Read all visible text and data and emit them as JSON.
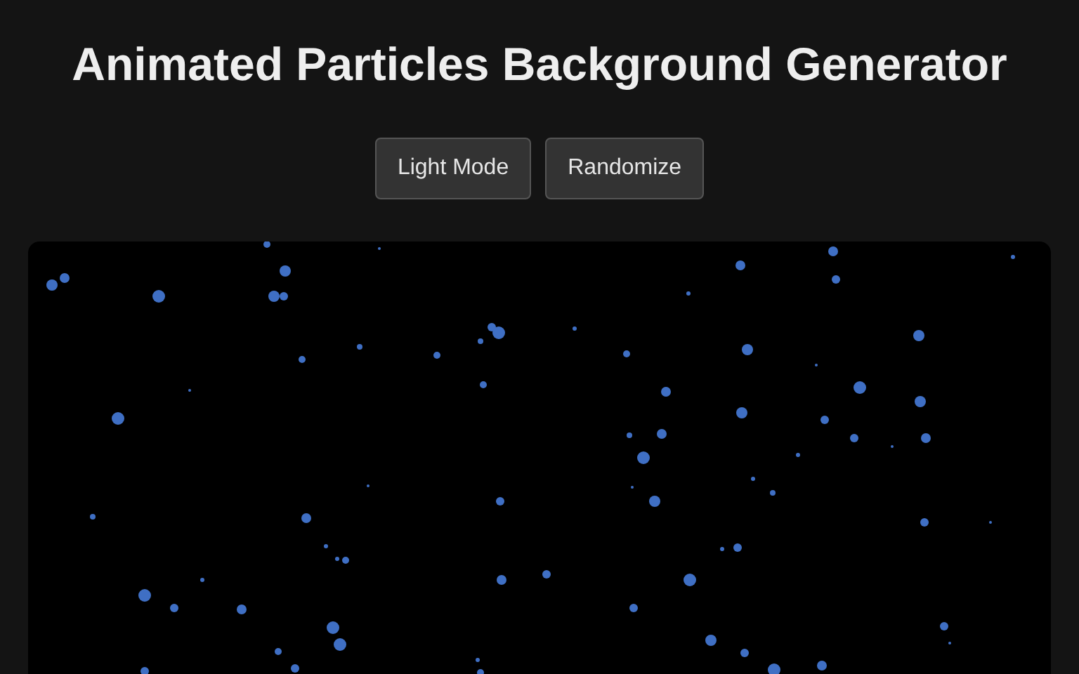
{
  "title": "Animated Particles Background Generator",
  "buttons": [
    "Light Mode",
    "Randomize"
  ]
}
